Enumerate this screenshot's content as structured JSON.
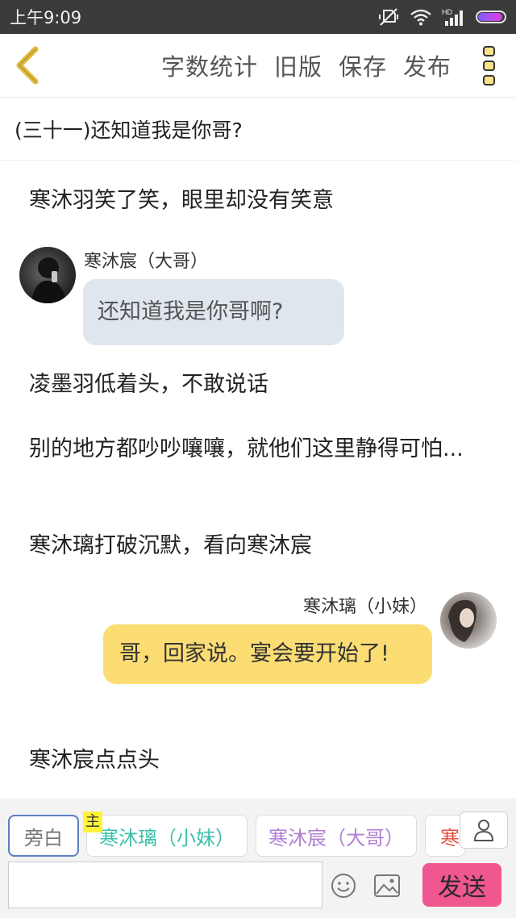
{
  "status_bar": {
    "time": "上午9:09",
    "icons": [
      "mute-vibrate-icon",
      "wifi-icon",
      "hd-signal-icon",
      "battery-icon"
    ],
    "hd_label": "HD"
  },
  "toolbar": {
    "word_count": "字数统计",
    "old_version": "旧版",
    "save": "保存",
    "publish": "发布"
  },
  "chapter": {
    "title": "(三十一)还知道我是你哥?"
  },
  "content": {
    "narration_1": "寒沐羽笑了笑，眼里却没有笑意",
    "dialogue_1": {
      "speaker": "寒沐宸（大哥）",
      "text": "还知道我是你哥啊?"
    },
    "narration_2": "凌墨羽低着头，不敢说话",
    "narration_3": "别的地方都吵吵嚷嚷，就他们这里静得可怕...",
    "narration_4": "寒沐璃打破沉默，看向寒沐宸",
    "dialogue_2": {
      "speaker": "寒沐璃（小妹）",
      "text": "哥，回家说。宴会要开始了!"
    },
    "narration_5": "寒沐宸点点头"
  },
  "bottom": {
    "narration_chip": "旁白",
    "main_badge": "主",
    "chip_sister": "寒沐璃（小妹）",
    "chip_brother": "寒沐宸（大哥）",
    "chip_partial": "寒",
    "input_value": "",
    "input_placeholder": "",
    "send": "发送"
  },
  "colors": {
    "accent_yellow": "#fbdd74",
    "send_pink": "#f0568f",
    "left_bubble": "#dfe6ee",
    "sister_label": "#3bbfa9",
    "brother_label": "#b07fd0",
    "back_icon": "#e2b93b"
  }
}
